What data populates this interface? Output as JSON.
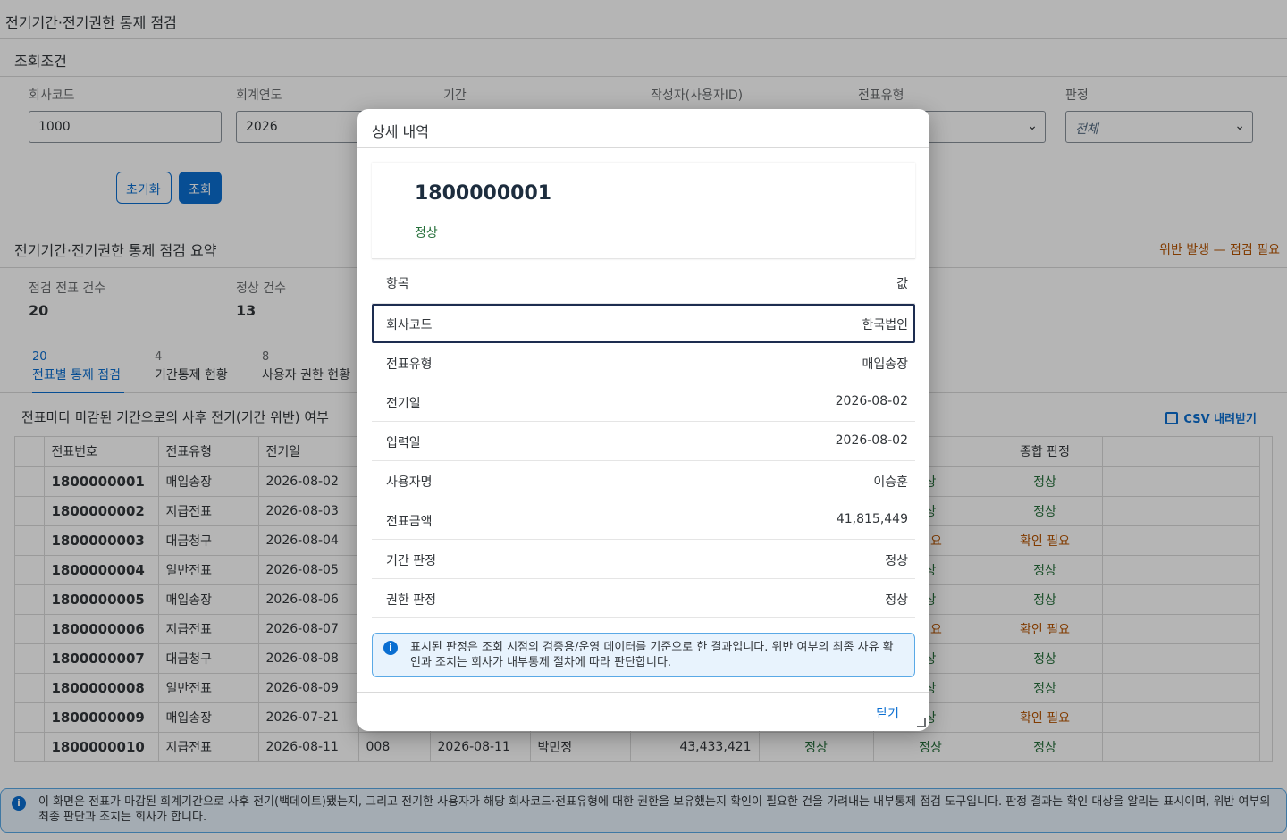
{
  "app": {
    "title": "전기기간·전기권한 통제 점검"
  },
  "filters": {
    "header": "조회조건",
    "company_code": {
      "label": "회사코드",
      "value": "1000"
    },
    "fiscal_year": {
      "label": "회계연도",
      "value": "2026"
    },
    "period": {
      "label": "기간"
    },
    "creator": {
      "label": "작성자(사용자ID)"
    },
    "doc_type": {
      "label": "전표유형"
    },
    "verdict": {
      "label": "판정",
      "value": "전체"
    },
    "reset_label": "초기화",
    "search_label": "조회"
  },
  "summary": {
    "title": "전기기간·전기권한 통제 점검 요약",
    "warning": "위반 발생 — 점검 필요",
    "kpis": [
      {
        "label": "점검 전표 건수",
        "value": "20"
      },
      {
        "label": "정상 건수",
        "value": "13"
      }
    ]
  },
  "tabs": [
    {
      "count": "20",
      "label": "전표별 통제 점검"
    },
    {
      "count": "4",
      "label": "기간통제 현황"
    },
    {
      "count": "8",
      "label": "사용자 권한 현황"
    }
  ],
  "table": {
    "description": "전표마다 마감된 기간으로의 사후 전기(기간 위반) 여부",
    "csv_label": "CSV 내려받기",
    "columns": [
      "전표번호",
      "전표유형",
      "전기일",
      "판정",
      "종합 판정"
    ],
    "rows": [
      {
        "doc": "1800000001",
        "type": "매입송장",
        "post": "2026-08-02",
        "auth": "상",
        "total": "정상",
        "total_status": "ok"
      },
      {
        "doc": "1800000002",
        "type": "지급전표",
        "post": "2026-08-03",
        "auth": "상",
        "total": "정상",
        "total_status": "ok"
      },
      {
        "doc": "1800000003",
        "type": "대금청구",
        "post": "2026-08-04",
        "auth": "필요",
        "total": "확인 필요",
        "total_status": "chk"
      },
      {
        "doc": "1800000004",
        "type": "일반전표",
        "post": "2026-08-05",
        "auth": "상",
        "total": "정상",
        "total_status": "ok"
      },
      {
        "doc": "1800000005",
        "type": "매입송장",
        "post": "2026-08-06",
        "auth": "상",
        "total": "정상",
        "total_status": "ok"
      },
      {
        "doc": "1800000006",
        "type": "지급전표",
        "post": "2026-08-07",
        "auth": "필요",
        "total": "확인 필요",
        "total_status": "chk"
      },
      {
        "doc": "1800000007",
        "type": "대금청구",
        "post": "2026-08-08",
        "auth": "상",
        "total": "정상",
        "total_status": "ok"
      },
      {
        "doc": "1800000008",
        "type": "일반전표",
        "post": "2026-08-09",
        "auth": "상",
        "total": "정상",
        "total_status": "ok"
      },
      {
        "doc": "1800000009",
        "type": "매입송장",
        "post": "2026-07-21",
        "auth": "상",
        "total": "확인 필요",
        "total_status": "chk"
      },
      {
        "doc": "1800000010",
        "type": "지급전표",
        "post": "2026-08-11",
        "auth": "정상",
        "total": "정상",
        "total_status": "ok",
        "user_code": "008",
        "entry": "2026-08-11",
        "user": "박민정",
        "amount": "43,433,421",
        "period": "정상"
      }
    ]
  },
  "footer_note": "이 화면은 전표가 마감된 회계기간으로 사후 전기(백데이트)됐는지, 그리고 전기한 사용자가 해당 회사코드·전표유형에 대한 권한을 보유했는지 확인이 필요한 건을 가려내는 내부통제 점검 도구입니다. 판정 결과는 확인 대상을 알리는 표시이며, 위반 여부의 최종 판단과 조치는 회사가 합니다.",
  "dialog": {
    "title": "상세 내역",
    "doc_id": "1800000001",
    "status": "정상",
    "header_key": "항목",
    "header_value": "값",
    "rows": [
      {
        "key": "회사코드",
        "value": "한국법인"
      },
      {
        "key": "전표유형",
        "value": "매입송장"
      },
      {
        "key": "전기일",
        "value": "2026-08-02"
      },
      {
        "key": "입력일",
        "value": "2026-08-02"
      },
      {
        "key": "사용자명",
        "value": "이승훈"
      },
      {
        "key": "전표금액",
        "value": "41,815,449"
      },
      {
        "key": "기간 판정",
        "value": "정상"
      },
      {
        "key": "권한 판정",
        "value": "정상"
      }
    ],
    "info": "표시된 판정은 조회 시점의 검증용/운영 데이터를 기준으로 한 결과입니다. 위반 여부의 최종 사유 확인과 조치는 회사가 내부통제 절차에 따라 판단합니다.",
    "close_label": "닫기"
  }
}
